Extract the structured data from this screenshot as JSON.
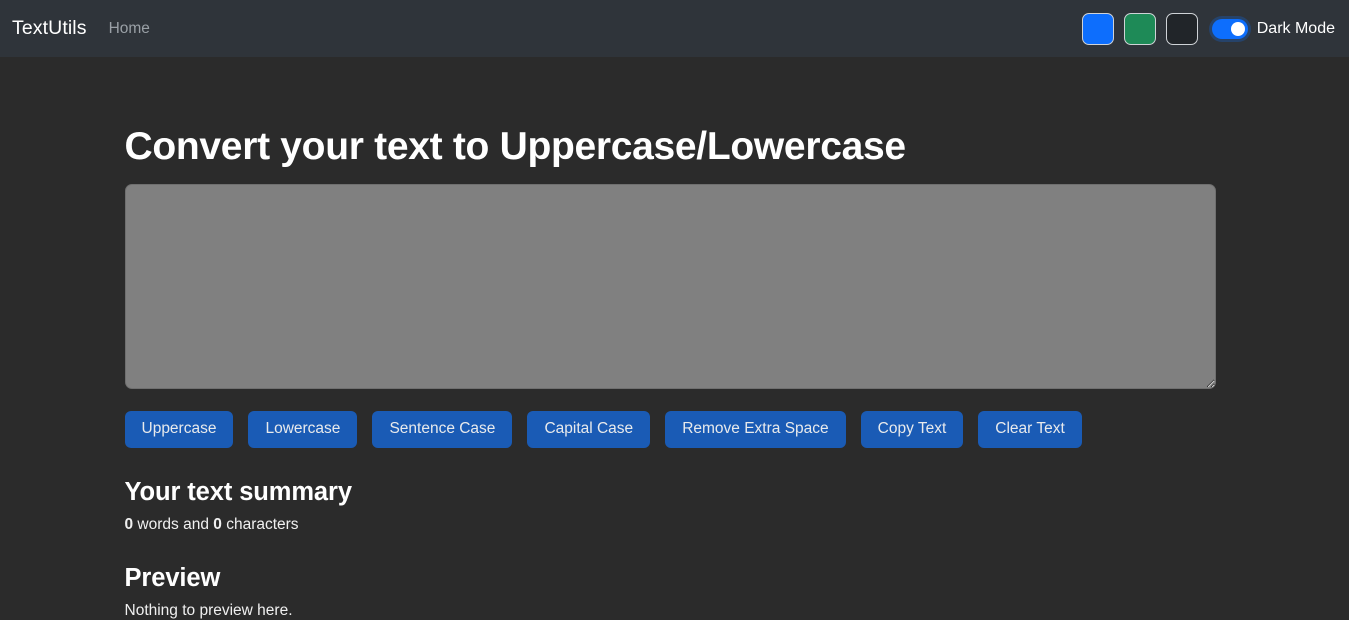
{
  "navbar": {
    "brand": "TextUtils",
    "links": [
      {
        "label": "Home",
        "name": "nav-link-home"
      }
    ],
    "swatches": [
      {
        "name": "swatch-blue",
        "color": "#0d6efd"
      },
      {
        "name": "swatch-green",
        "color": "#1e8a57"
      },
      {
        "name": "swatch-dark",
        "color": "#212529"
      }
    ],
    "toggle": {
      "label": "Dark Mode",
      "checked": true,
      "on_color": "#0d6efd",
      "knob_color": "#ffffff"
    }
  },
  "main": {
    "title": "Convert your text to Uppercase/Lowercase",
    "textarea": {
      "value": "",
      "placeholder": "",
      "background": "#808080"
    },
    "buttons": [
      {
        "label": "Uppercase",
        "name": "uppercase-button"
      },
      {
        "label": "Lowercase",
        "name": "lowercase-button"
      },
      {
        "label": "Sentence Case",
        "name": "sentence-case-button"
      },
      {
        "label": "Capital Case",
        "name": "capital-case-button"
      },
      {
        "label": "Remove Extra Space",
        "name": "remove-extra-space-button"
      },
      {
        "label": "Copy Text",
        "name": "copy-text-button"
      },
      {
        "label": "Clear Text",
        "name": "clear-text-button"
      }
    ],
    "summary": {
      "heading": "Your text summary",
      "word_count": "0",
      "words_label": " words and ",
      "char_count": "0",
      "chars_label": " characters"
    },
    "preview": {
      "heading": "Preview",
      "empty_text": "Nothing to preview here."
    }
  },
  "theme": {
    "page_background": "#2b2b2b",
    "navbar_background": "#2f343a",
    "button_primary": "#1a5bb5",
    "text_primary": "#ffffff",
    "text_muted": "#9aa0a6"
  }
}
